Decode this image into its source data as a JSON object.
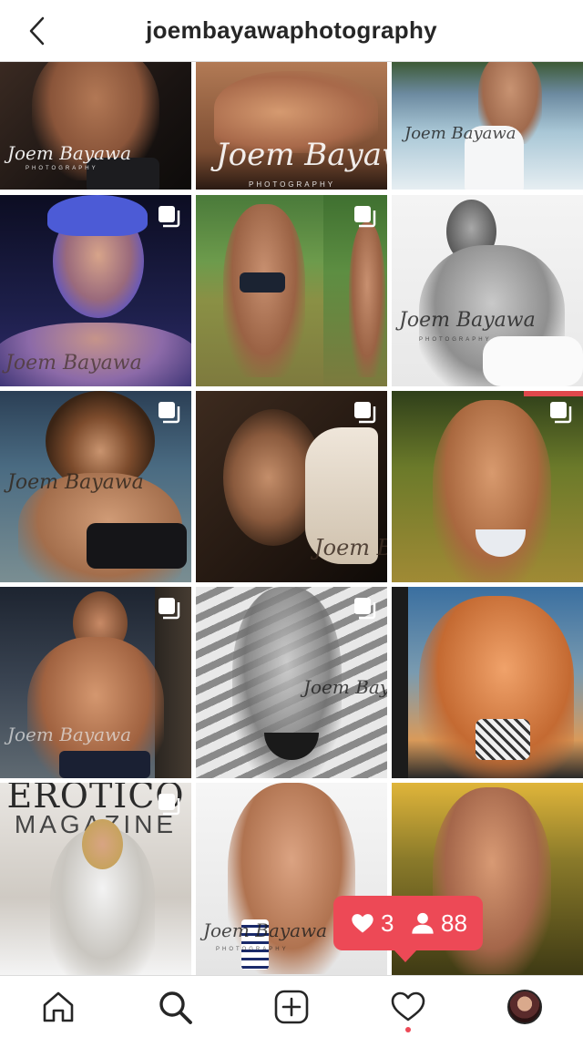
{
  "header": {
    "title": "joembayawaphotography",
    "back_icon": "chevron-left-icon"
  },
  "watermark": {
    "signature": "Joem Bayawa",
    "sub": "PHOTOGRAPHY"
  },
  "magazine": {
    "title_top": "EROTICO",
    "title_bottom": "MAGAZINE"
  },
  "posts": [
    {
      "id": "post-1",
      "multi": false
    },
    {
      "id": "post-2",
      "multi": false
    },
    {
      "id": "post-3",
      "multi": false
    },
    {
      "id": "post-4",
      "multi": true
    },
    {
      "id": "post-5",
      "multi": true
    },
    {
      "id": "post-6",
      "multi": false
    },
    {
      "id": "post-7",
      "multi": true
    },
    {
      "id": "post-8",
      "multi": true
    },
    {
      "id": "post-9",
      "multi": true
    },
    {
      "id": "post-10",
      "multi": true
    },
    {
      "id": "post-11",
      "multi": true
    },
    {
      "id": "post-12",
      "multi": false
    },
    {
      "id": "post-13",
      "multi": true
    },
    {
      "id": "post-14",
      "multi": false
    },
    {
      "id": "post-15",
      "multi": false
    }
  ],
  "notification": {
    "likes_count": "3",
    "followers_count": "88",
    "color": "#ed4956"
  },
  "bottom_nav": {
    "items": [
      {
        "icon": "home-icon"
      },
      {
        "icon": "search-icon",
        "active": true
      },
      {
        "icon": "add-post-icon"
      },
      {
        "icon": "heart-icon",
        "has_dot": true
      },
      {
        "icon": "profile-avatar"
      }
    ]
  }
}
